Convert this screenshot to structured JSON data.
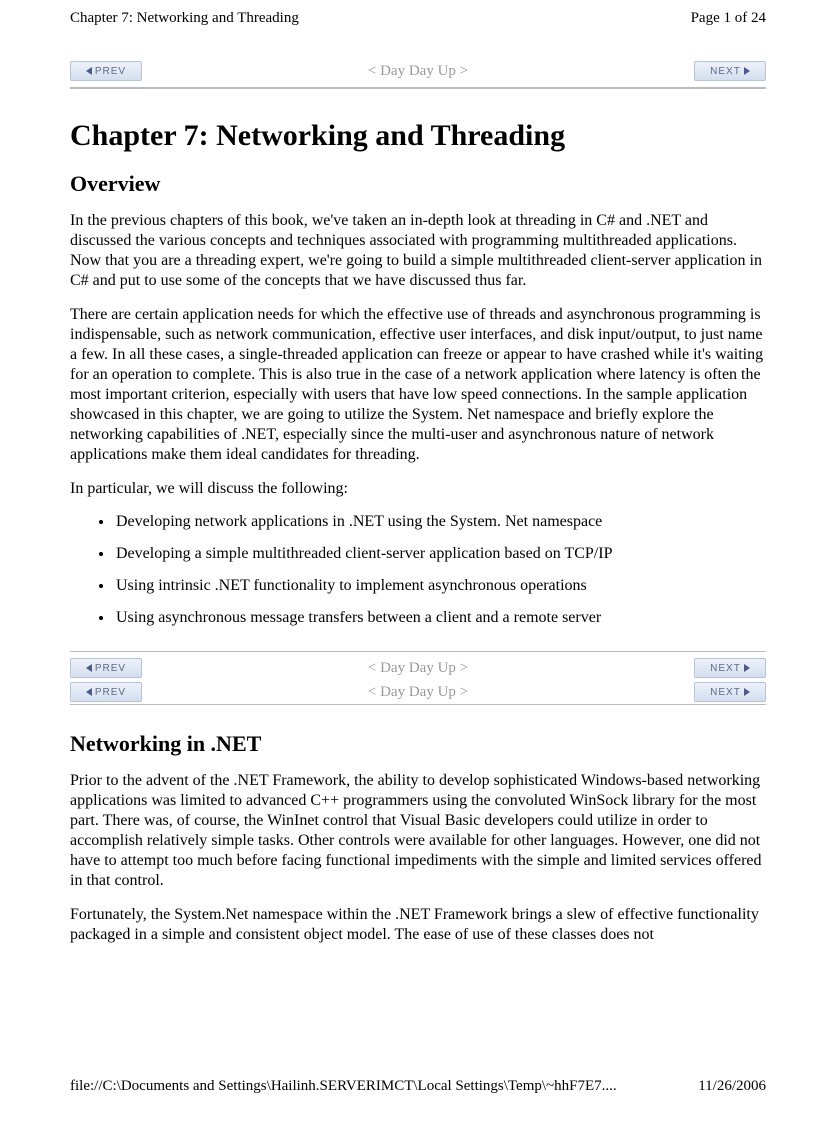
{
  "header": {
    "left": "Chapter 7: Networking and Threading",
    "right": "Page 1 of 24"
  },
  "nav": {
    "prev_label": "PREV",
    "next_label": "NEXT",
    "center_label": "< Day Day Up >"
  },
  "chapter_title": "Chapter 7: Networking and Threading",
  "section1_title": "Overview",
  "para1": "In the previous chapters of this book, we've taken an in-depth look at threading in C# and .NET and discussed the various concepts and techniques associated with programming multithreaded applications. Now that you are a threading expert, we're going to build a simple multithreaded client-server application in C# and put to use some of the concepts that we have discussed thus far.",
  "para2": "There are certain application needs for which the effective use of threads and asynchronous programming is indispensable, such as network communication, effective user interfaces, and disk input/output, to just name a few. In all these cases, a single-threaded application can freeze or appear to have crashed while it's waiting for an operation to complete. This is also true in the case of a network application where latency is often the most important criterion, especially with users that have low speed connections. In the sample application showcased in this chapter, we are going to utilize the System. Net namespace and briefly explore the networking capabilities of .NET, especially since the multi-user and asynchronous nature of network applications make them ideal candidates for threading.",
  "para3": "In particular, we will discuss the following:",
  "bullets": [
    "Developing network applications in .NET using the System. Net namespace",
    "Developing a simple multithreaded client-server application based on TCP/IP",
    "Using intrinsic .NET functionality to implement asynchronous operations",
    "Using asynchronous message transfers between a client and a remote server"
  ],
  "section2_title": "Networking in .NET",
  "para4": "Prior to the advent of the .NET Framework, the ability to develop sophisticated Windows-based networking applications was limited to advanced C++ programmers using the convoluted WinSock library for the most part. There was, of course, the WinInet control that Visual Basic developers could utilize in order to accomplish relatively simple tasks. Other controls were available for other languages. However, one did not have to attempt too much before facing functional impediments with the simple and limited services offered in that control.",
  "para5": "Fortunately, the System.Net namespace within the .NET Framework brings a slew of effective functionality packaged in a simple and consistent object model. The ease of use of these classes does not",
  "footer": {
    "path": "file://C:\\Documents and Settings\\Hailinh.SERVERIMCT\\Local Settings\\Temp\\~hhF7E7....",
    "date": "11/26/2006"
  }
}
